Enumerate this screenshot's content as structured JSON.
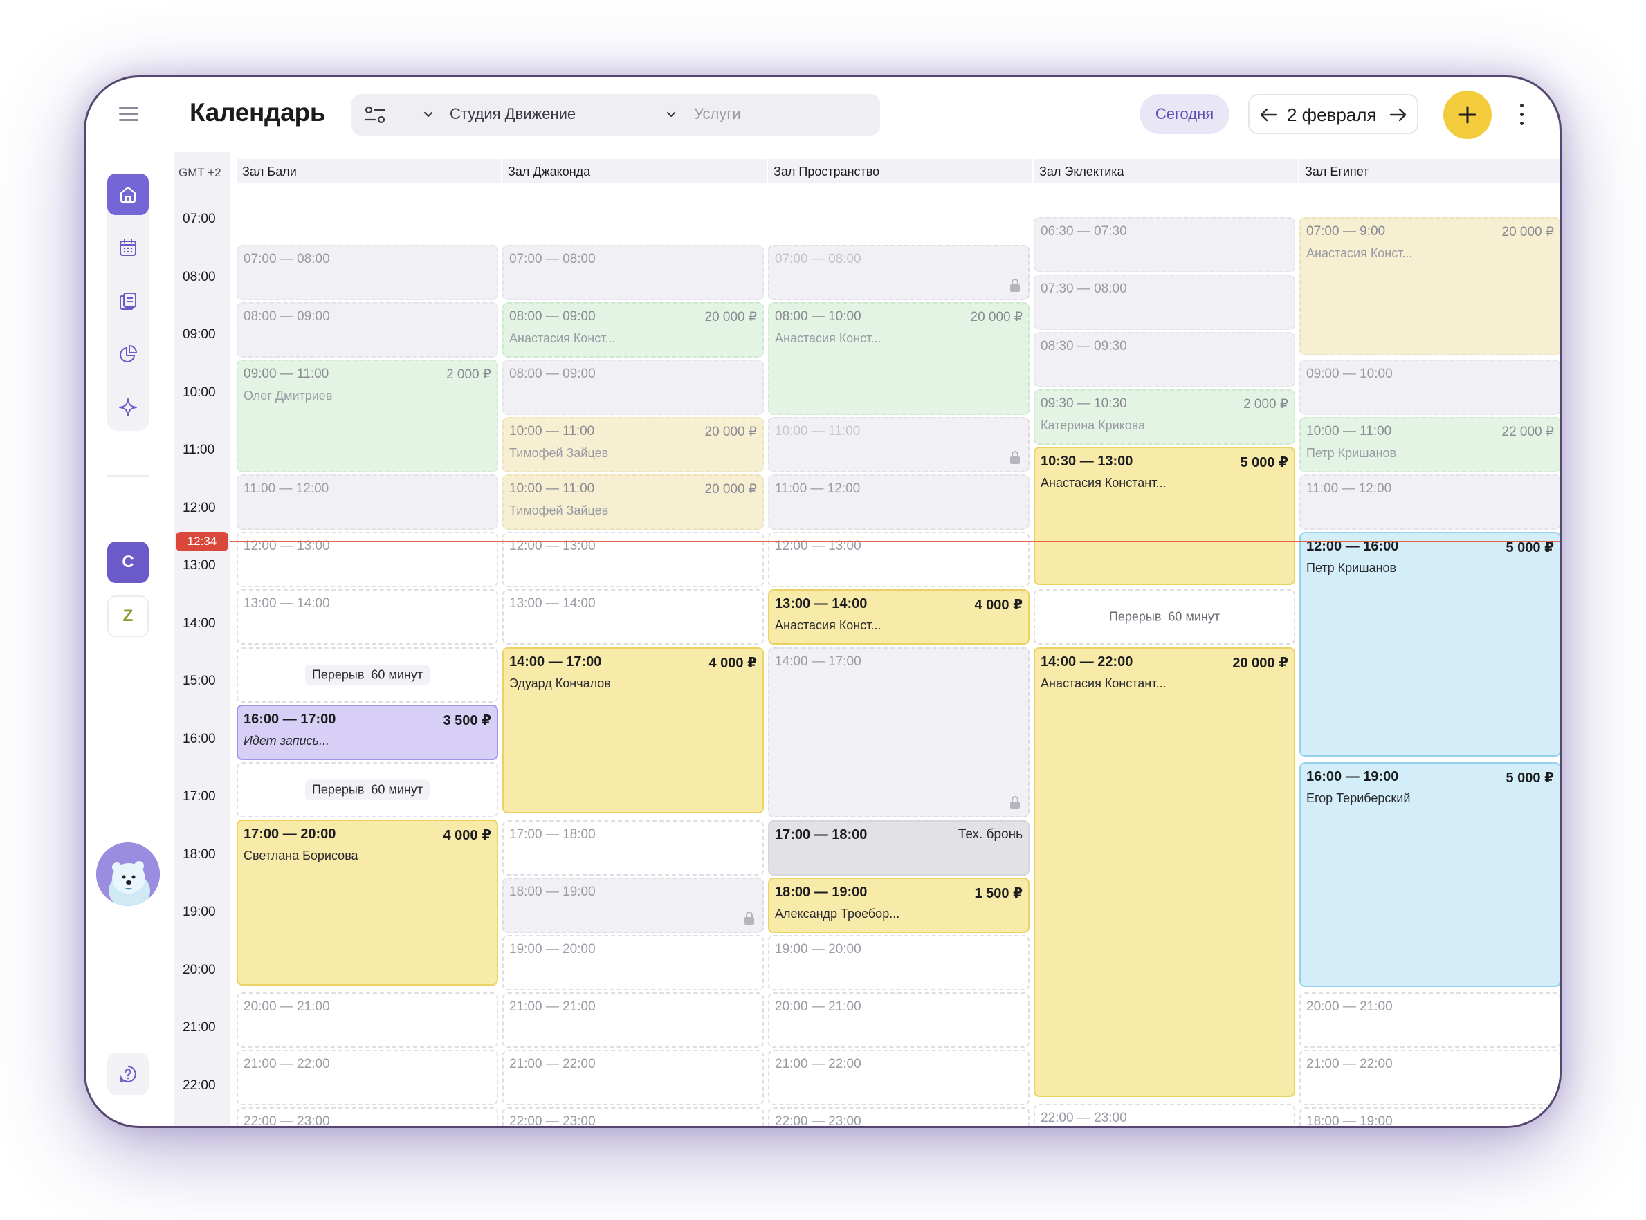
{
  "header": {
    "title": "Календарь",
    "studio_filter": "Студия Движение",
    "services_placeholder": "Услуги",
    "today_label": "Сегодня",
    "date_label": "2 февраля"
  },
  "sidebar": {
    "nav_items": [
      "home-icon",
      "calendar-icon",
      "documents-icon",
      "analytics-icon",
      "sparkle-icon"
    ],
    "accounts": [
      "C",
      "Z"
    ],
    "help_icon": "help-icon"
  },
  "calendar": {
    "timezone": "GMT +2",
    "now_time": "12:34",
    "hours": [
      "07:00",
      "08:00",
      "09:00",
      "10:00",
      "11:00",
      "12:00",
      "13:00",
      "14:00",
      "15:00",
      "16:00",
      "17:00",
      "18:00",
      "19:00",
      "20:00",
      "21:00",
      "22:00"
    ],
    "columns": [
      {
        "name": "Зал Бали",
        "slots": [
          {
            "kind": "unavail",
            "time": "07:00 — 08:00"
          },
          {
            "kind": "unavail",
            "time": "08:00 — 09:00"
          },
          {
            "kind": "green",
            "time": "09:00 — 11:00",
            "price": "2 000 ₽",
            "name": "Олег Дмитриев"
          },
          {
            "kind": "unavail",
            "time": "11:00 — 12:00"
          },
          {
            "kind": "empty",
            "time": "12:00 — 13:00"
          },
          {
            "kind": "empty",
            "time": "13:00 — 14:00"
          },
          {
            "kind": "break",
            "label": "Перерыв",
            "duration": "60 минут"
          },
          {
            "kind": "purple",
            "time": "16:00 — 17:00",
            "price": "3 500 ₽",
            "name": "Идет запись..."
          },
          {
            "kind": "break",
            "label": "Перерыв",
            "duration": "60 минут"
          },
          {
            "kind": "yellow",
            "time": "17:00 — 20:00",
            "price": "4 000 ₽",
            "name": "Светлана Борисова"
          },
          {
            "kind": "empty",
            "time": "20:00 — 21:00"
          },
          {
            "kind": "empty",
            "time": "21:00 — 22:00"
          },
          {
            "kind": "empty",
            "time": "22:00 — 23:00"
          }
        ]
      },
      {
        "name": "Зал Джаконда",
        "slots": [
          {
            "kind": "unavail",
            "time": "07:00 — 08:00"
          },
          {
            "kind": "green",
            "time": "08:00 — 09:00",
            "price": "20 000 ₽",
            "name": "Анастасия Конст..."
          },
          {
            "kind": "unavail",
            "time": "08:00 — 09:00"
          },
          {
            "kind": "beige",
            "time": "10:00 — 11:00",
            "price": "20 000 ₽",
            "name": "Тимофей Зайцев"
          },
          {
            "kind": "beige",
            "time": "10:00 — 11:00",
            "price": "20 000 ₽",
            "name": "Тимофей Зайцев"
          },
          {
            "kind": "empty",
            "time": "12:00 — 13:00"
          },
          {
            "kind": "empty",
            "time": "13:00 — 14:00"
          },
          {
            "kind": "yellow",
            "time": "14:00 — 17:00",
            "price": "4 000 ₽",
            "name": "Эдуард Кончалов"
          },
          {
            "kind": "empty",
            "time": "17:00 — 18:00"
          },
          {
            "kind": "locked",
            "time": "18:00 — 19:00"
          },
          {
            "kind": "empty",
            "time": "19:00 — 20:00"
          },
          {
            "kind": "empty",
            "time": "21:00 — 21:00"
          },
          {
            "kind": "empty",
            "time": "21:00 — 22:00"
          },
          {
            "kind": "empty",
            "time": "22:00 — 23:00"
          }
        ]
      },
      {
        "name": "Зал Пространство",
        "slots": [
          {
            "kind": "locked",
            "time": "07:00 — 08:00"
          },
          {
            "kind": "green",
            "time": "08:00 — 10:00",
            "price": "20 000 ₽",
            "name": "Анастасия Конст..."
          },
          {
            "kind": "locked",
            "time": "10:00 — 11:00"
          },
          {
            "kind": "unavail",
            "time": "11:00 — 12:00"
          },
          {
            "kind": "empty",
            "time": "12:00 — 13:00"
          },
          {
            "kind": "yellow",
            "time": "13:00 — 14:00",
            "price": "4 000 ₽",
            "name": "Анастасия Конст..."
          },
          {
            "kind": "locked",
            "time": "14:00 — 17:00"
          },
          {
            "kind": "gray",
            "time": "17:00 — 18:00",
            "price": "Тех. бронь"
          },
          {
            "kind": "yellow",
            "time": "18:00 — 19:00",
            "price": "1 500 ₽",
            "name": "Александр Троебор..."
          },
          {
            "kind": "empty",
            "time": "19:00 — 20:00"
          },
          {
            "kind": "empty",
            "time": "20:00 — 21:00"
          },
          {
            "kind": "empty",
            "time": "21:00 — 22:00"
          },
          {
            "kind": "empty",
            "time": "22:00 — 23:00"
          }
        ]
      },
      {
        "name": "Зал Эклектика",
        "slots": [
          {
            "kind": "unavail",
            "time": "06:30 — 07:30"
          },
          {
            "kind": "unavail",
            "time": "07:30 — 08:00"
          },
          {
            "kind": "unavail",
            "time": "08:30 — 09:30"
          },
          {
            "kind": "green",
            "time": "09:30 — 10:30",
            "price": "2 000 ₽",
            "name": "Катерина Крикова"
          },
          {
            "kind": "yellow",
            "time": "10:30 — 13:00",
            "price": "5 000 ₽",
            "name": "Анастасия Констант..."
          },
          {
            "kind": "break",
            "label": "Перерыв",
            "duration": "60 минут"
          },
          {
            "kind": "yellow",
            "time": "14:00 — 22:00",
            "price": "20 000 ₽",
            "name": "Анастасия Констант..."
          },
          {
            "kind": "empty",
            "time": "22:00 — 23:00"
          }
        ]
      },
      {
        "name": "Зал Египет",
        "slots": [
          {
            "kind": "beige",
            "time": "07:00 — 9:00",
            "price": "20 000 ₽",
            "name": "Анастасия Конст..."
          },
          {
            "kind": "unavail",
            "time": "09:00 — 10:00"
          },
          {
            "kind": "green",
            "time": "10:00 — 11:00",
            "price": "22 000 ₽",
            "name": "Петр Кришанов"
          },
          {
            "kind": "unavail",
            "time": "11:00 — 12:00"
          },
          {
            "kind": "blue",
            "time": "12:00 — 16:00",
            "price": "5 000 ₽",
            "name": "Петр Кришанов"
          },
          {
            "kind": "blue",
            "time": "16:00 — 19:00",
            "price": "5 000 ₽",
            "name": "Егор Териберский"
          },
          {
            "kind": "empty",
            "time": "20:00 — 21:00"
          },
          {
            "kind": "empty",
            "time": "21:00 — 22:00"
          },
          {
            "kind": "empty",
            "time": "18:00 — 19:00"
          }
        ]
      }
    ]
  },
  "colors": {
    "accent": "#7466d4",
    "add_button": "#f2cc3c",
    "now_indicator": "#d9483a",
    "booking_yellow": "#f8eba9",
    "booking_blue": "#d3eef9",
    "booking_green": "#e3f4e4",
    "booking_purple": "#d8cff7"
  }
}
